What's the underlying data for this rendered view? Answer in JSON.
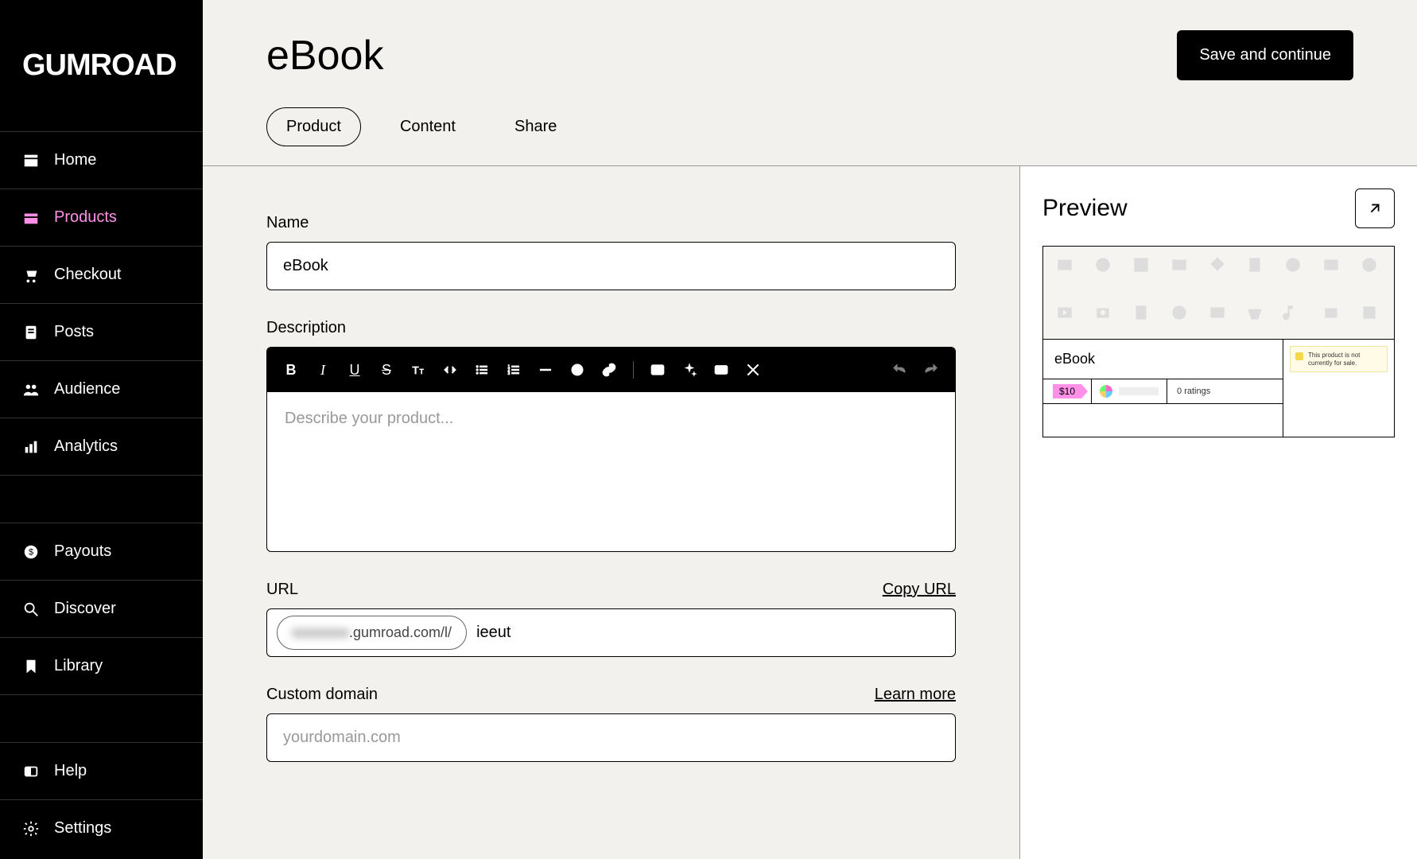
{
  "brand": "GUMROAD",
  "sidebar": {
    "items": [
      {
        "label": "Home",
        "icon": "home-icon"
      },
      {
        "label": "Products",
        "icon": "products-icon"
      },
      {
        "label": "Checkout",
        "icon": "checkout-icon"
      },
      {
        "label": "Posts",
        "icon": "posts-icon"
      },
      {
        "label": "Audience",
        "icon": "audience-icon"
      },
      {
        "label": "Analytics",
        "icon": "analytics-icon"
      }
    ],
    "secondary": [
      {
        "label": "Payouts",
        "icon": "payouts-icon"
      },
      {
        "label": "Discover",
        "icon": "discover-icon"
      },
      {
        "label": "Library",
        "icon": "library-icon"
      }
    ],
    "footer": [
      {
        "label": "Help",
        "icon": "help-icon"
      },
      {
        "label": "Settings",
        "icon": "settings-icon"
      }
    ]
  },
  "header": {
    "title": "eBook",
    "save_label": "Save and continue"
  },
  "tabs": [
    "Product",
    "Content",
    "Share"
  ],
  "form": {
    "name_label": "Name",
    "name_value": "eBook",
    "description_label": "Description",
    "description_placeholder": "Describe your product...",
    "url_label": "URL",
    "copy_url_label": "Copy URL",
    "url_prefix_masked": "xxxxxxxx",
    "url_prefix_visible": ".gumroad.com/l/",
    "url_slug": "ieeut",
    "custom_domain_label": "Custom domain",
    "learn_more_label": "Learn more",
    "custom_domain_placeholder": "yourdomain.com"
  },
  "preview": {
    "title": "Preview",
    "product_name": "eBook",
    "price": "$10",
    "ratings": "0 ratings",
    "notice": "This product is not currently for sale."
  },
  "colors": {
    "accent": "#ff90e8"
  }
}
